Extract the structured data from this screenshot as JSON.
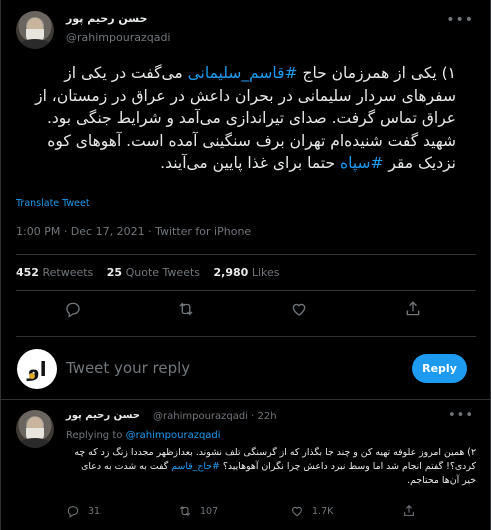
{
  "tweet": {
    "author_name": "حسن رحیم پور",
    "author_handle": "@rahimpourazqadi",
    "more_icon": "more-horizontal-icon",
    "text_parts": [
      "۱) یکی از همرزمان حاج ",
      "#قاسم_سلیمانی",
      " می‌گفت در یکی از سفرهای سردار سلیمانی در بحران داعش در عراق در زمستان، از عراق تماس گرفت. صدای تیراندازی می‌آمد و شرایط جنگی بود. شهید گفت شنیده‌ام تهران برف سنگینی آمده است. آهوهای کوه نزدیک مقر ",
      "#سپاه",
      " حتما برای غذا پایین می‌آیند."
    ],
    "translate_label": "Translate Tweet",
    "timestamp": "1:00 PM · Dec 17, 2021 · Twitter for iPhone",
    "stats": {
      "retweets_count": "452",
      "retweets_label": "Retweets",
      "quotes_count": "25",
      "quotes_label": "Quote Tweets",
      "likes_count": "2,980",
      "likes_label": "Likes"
    }
  },
  "composer": {
    "placeholder": "Tweet your reply",
    "reply_button": "Reply",
    "logo_text": "او"
  },
  "reply": {
    "author_name": "حسن رحیم پور",
    "author_handle": "@rahimpourazqadi · 22h",
    "replying_prefix": "Replying to ",
    "replying_to": "@rahimpourazqadi",
    "text_parts": [
      "۲) همین امروز علوفه تهیه کن و چند جا بگذار که از گرسنگی تلف نشوند. بعدازظهر مجددا زنگ زد که چه کردی؟! گفتم انجام شد اما وسط نبرد داعش چرا نگران آهوهایید؟ ",
      "#حاج_قاسم",
      " گفت به شدت به دعای خیر آن‌ها محتاجم."
    ],
    "replies": "31",
    "retweets": "107",
    "likes": "1.7K"
  },
  "colors": {
    "background": "#000000",
    "link": "#1d9bf0",
    "muted": "#71767b",
    "text": "#e7e9ea",
    "divider": "#2f3336"
  }
}
